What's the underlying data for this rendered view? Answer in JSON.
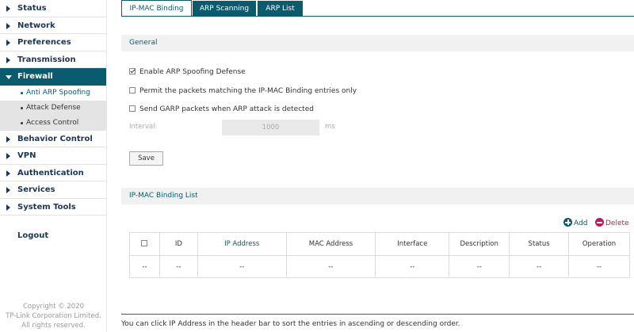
{
  "sidebar": {
    "items": [
      {
        "label": "Status"
      },
      {
        "label": "Network"
      },
      {
        "label": "Preferences"
      },
      {
        "label": "Transmission"
      },
      {
        "label": "Firewall",
        "active": true,
        "children": [
          {
            "label": "Anti ARP Spoofing",
            "active": true
          },
          {
            "label": "Attack Defense"
          },
          {
            "label": "Access Control"
          }
        ]
      },
      {
        "label": "Behavior Control"
      },
      {
        "label": "VPN"
      },
      {
        "label": "Authentication"
      },
      {
        "label": "Services"
      },
      {
        "label": "System Tools"
      }
    ],
    "logout": "Logout",
    "copyright": [
      "Copyright © 2020",
      "TP-Link Corporation Limited.",
      "All rights reserved."
    ]
  },
  "tabs": [
    {
      "label": "IP-MAC Binding",
      "active": true
    },
    {
      "label": "ARP Scanning"
    },
    {
      "label": "ARP List"
    }
  ],
  "general": {
    "title": "General",
    "options": [
      {
        "label": "Enable ARP Spoofing Defense",
        "checked": true
      },
      {
        "label": "Permit the packets matching the IP-MAC Binding entries only",
        "checked": false
      },
      {
        "label": "Send GARP packets when ARP attack is detected",
        "checked": false
      }
    ],
    "interval_label": "Interval:",
    "interval_value": "1000",
    "interval_unit": "ms",
    "save_label": "Save"
  },
  "list": {
    "title": "IP-MAC Binding List",
    "add_label": "Add",
    "delete_label": "Delete",
    "columns": [
      "",
      "ID",
      "IP Address",
      "MAC Address",
      "Interface",
      "Description",
      "Status",
      "Operation"
    ],
    "rows": [
      [
        "--",
        "--",
        "--",
        "--",
        "--",
        "--",
        "--",
        "--"
      ]
    ]
  },
  "note": "You can click IP Address in the header bar to sort the entries in ascending or descending order.",
  "colors": {
    "accent": "#0a5b6d",
    "delete": "#c2185b"
  }
}
